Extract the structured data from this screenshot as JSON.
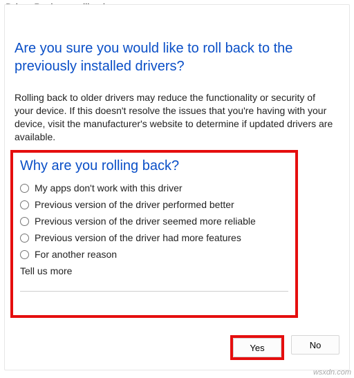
{
  "window": {
    "title": "Driver Package rollback"
  },
  "heading": "Are you sure you would like to roll back to the previously installed drivers?",
  "info": "Rolling back to older drivers may reduce the functionality or security of your device. If this doesn't resolve the issues that you're having with your device, visit the manufacturer's website to determine if updated drivers are available.",
  "reason": {
    "title": "Why are you rolling back?",
    "options": [
      "My apps don't work with this driver",
      "Previous version of the driver performed better",
      "Previous version of the driver seemed more reliable",
      "Previous version of the driver had more features",
      "For another reason"
    ],
    "tell_label": "Tell us more",
    "tell_value": ""
  },
  "buttons": {
    "yes": "Yes",
    "no": "No"
  },
  "watermark": "wsxdn.com",
  "highlight_color": "#e50e0e"
}
